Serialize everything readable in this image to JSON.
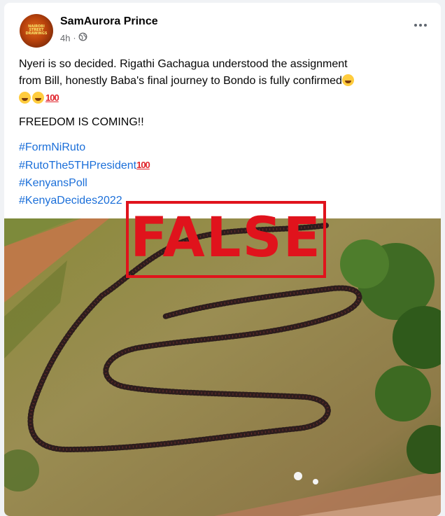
{
  "post": {
    "author": "SamAurora Prince",
    "time": "4h",
    "dot": "·",
    "audience_icon": "globe-icon",
    "avatar_text": "NAIROBI STREET DRAWINGS",
    "body_line1": "Nyeri is so decided. Rigathi Gachagua understood the assignment",
    "body_line2": "from Bill, honestly Baba's final journey to Bondo is fully confirmed",
    "freedom": "FREEDOM IS COMING!!",
    "hashtags": [
      "#FormNiRuto",
      "#RutoThe5THPresident",
      "#KenyansPoll",
      "#KenyaDecides2022"
    ],
    "hundred_symbol": "100",
    "stamp_label": "FALSE"
  },
  "colors": {
    "link": "#1b6fd9",
    "stamp": "#e0131c",
    "text": "#050505",
    "meta": "#65676b"
  }
}
